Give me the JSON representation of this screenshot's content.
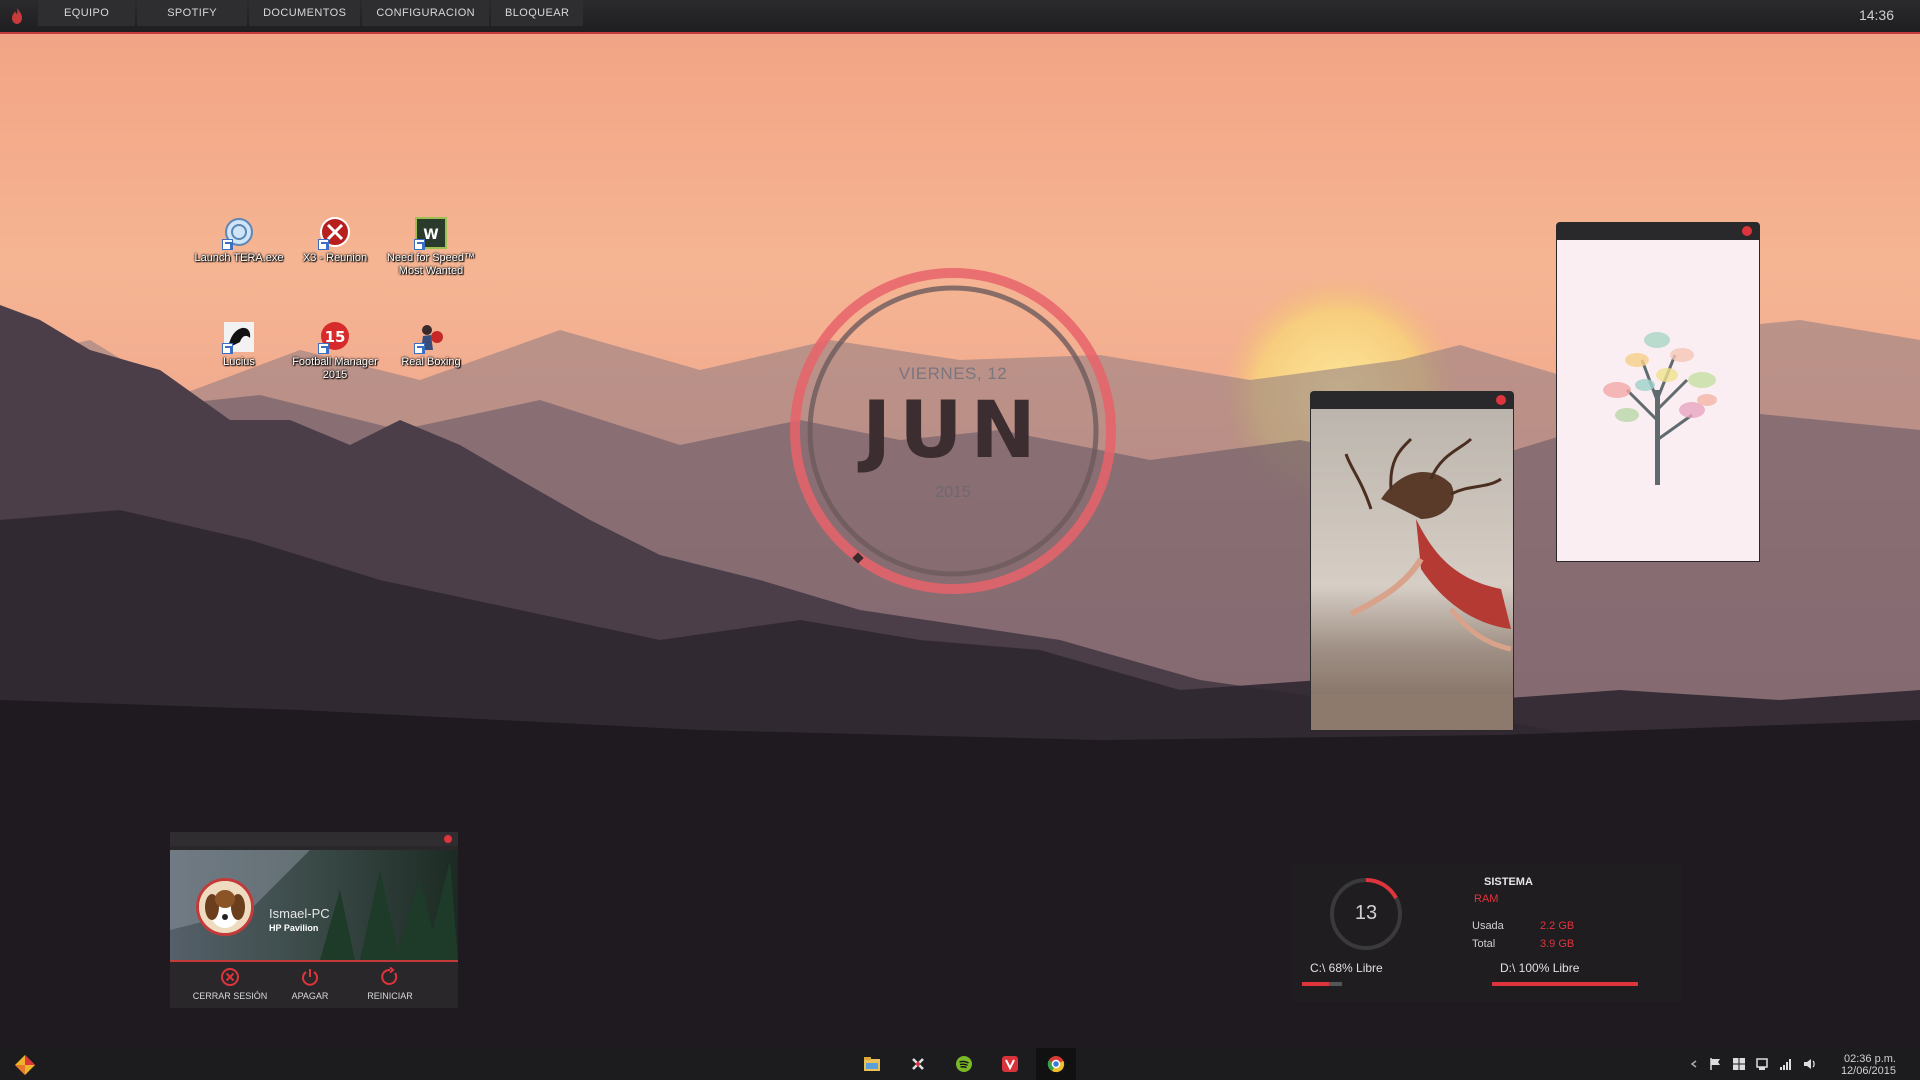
{
  "topbar": {
    "menu": [
      "EQUIPO",
      "SPOTIFY",
      "DOCUMENTOS",
      "CONFIGURACION",
      "BLOQUEAR"
    ],
    "clock": "14:36"
  },
  "desktop_icons": [
    {
      "label": "Launch TERA.exe"
    },
    {
      "label": "X3 - Reunion"
    },
    {
      "label": "Need for Speed™ Most Wanted"
    },
    {
      "label": "Lucius"
    },
    {
      "label": "Football Manager 2015"
    },
    {
      "label": "Real Boxing"
    }
  ],
  "date_widget": {
    "day": "VIERNES, 12",
    "month": "JUN",
    "year": "2015"
  },
  "user_widget": {
    "name": "Ismael-PC",
    "model": "HP Pavilion",
    "actions": [
      "CERRAR SESIÓN",
      "APAGAR",
      "REINICIAR"
    ]
  },
  "system_widget": {
    "title": "SISTEMA",
    "ram_label": "RAM",
    "used_label": "Usada",
    "used_value": "2.2 GB",
    "total_label": "Total",
    "total_value": "3.9 GB",
    "gauge_value": "13",
    "disk_c": "C:\\ 68% Libre",
    "disk_d": "D:\\ 100% Libre",
    "disk_c_free_pct": 68,
    "disk_d_free_pct": 100
  },
  "taskbar": {
    "time": "02:36 p.m.",
    "date": "12/06/2015",
    "apps": [
      "file-explorer-icon",
      "xsplit-icon",
      "spotify-icon",
      "vivaldi-icon",
      "chrome-icon"
    ]
  },
  "colors": {
    "accent": "#e0343c",
    "panel": "#29272a",
    "sky_top": "#f4a584",
    "mountain": "#4a3f48"
  }
}
